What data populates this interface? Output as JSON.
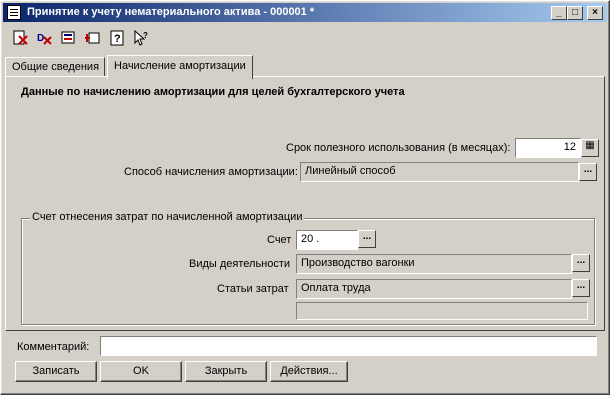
{
  "window": {
    "title": "Принятие к учету нематериального актива - 000001 *",
    "controls": {
      "minimize": "_",
      "maximize": "□",
      "close": "×"
    }
  },
  "toolbar": {
    "icons": [
      "delete-mark-icon",
      "delete-icon",
      "document-props-icon",
      "structure-icon",
      "help-icon",
      "context-help-icon"
    ],
    "help_glyph": "?",
    "context_help_glyph": "↖?"
  },
  "tabs": [
    {
      "label": "Общие сведения",
      "active": false
    },
    {
      "label": "Начисление амортизации",
      "active": true
    }
  ],
  "main": {
    "heading": "Данные по начислению амортизации для целей бухгалтерского учета",
    "useful_life_label": "Срок полезного использования (в месяцах):",
    "useful_life_value": "12",
    "method_label": "Способ начисления амортизации:",
    "method_value": "Линейный способ",
    "group_title": "Счет отнесения затрат по начисленной амортизации",
    "account_label": "Счет",
    "account_value": "20 .",
    "activity_label": "Виды деятельности",
    "activity_value": "Производство вагонки",
    "cost_item_label": "Статьи затрат",
    "cost_item_value": "Оплата труда",
    "extra_value": ""
  },
  "comment": {
    "label": "Комментарий:",
    "value": ""
  },
  "buttons": {
    "write": "Записать",
    "ok": "OK",
    "close": "Закрыть",
    "actions": "Действия..."
  },
  "picker_glyph": "...",
  "calc_glyph": "▦"
}
